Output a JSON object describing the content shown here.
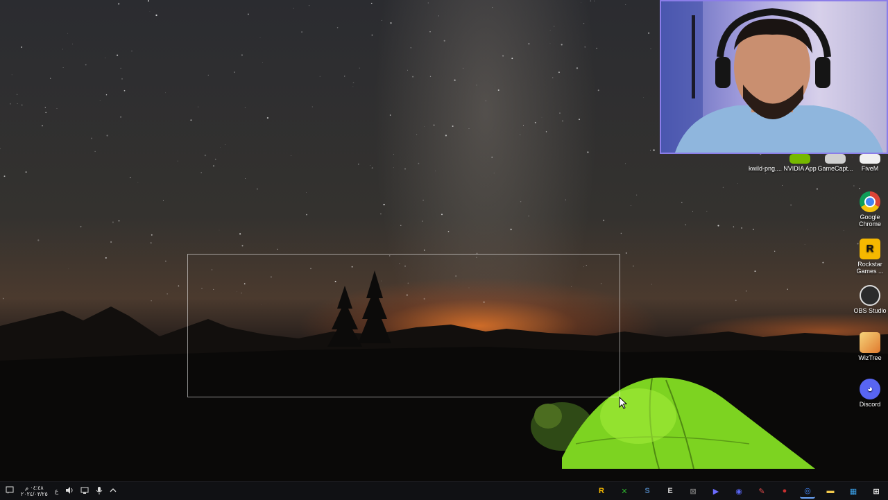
{
  "desktop_icons": [
    {
      "label": "kwild-png....",
      "icon": "image-file-icon",
      "color": "#9b8bd1"
    },
    {
      "label": "NVIDIA App",
      "icon": "nvidia-icon",
      "color": "#76b900"
    },
    {
      "label": "GameCapt...",
      "icon": "game-capture-icon",
      "color": "#c9c9c9"
    },
    {
      "label": "FiveM",
      "icon": "fivem-icon",
      "color": "#ffffff"
    },
    {
      "label": "Google Chrome",
      "icon": "chrome-icon",
      "color": "#4285f4"
    },
    {
      "label": "Rockstar Games ...",
      "icon": "rockstar-icon",
      "color": "#f5b800"
    },
    {
      "label": "OBS Studio",
      "icon": "obs-icon",
      "color": "#2b2b2b"
    },
    {
      "label": "WizTree",
      "icon": "wiztree-icon",
      "color": "#e89a3c"
    },
    {
      "label": "Discord",
      "icon": "discord-icon",
      "color": "#5865f2"
    }
  ],
  "taskbar": {
    "clock_time": "٠٤:٤٨ م",
    "clock_date": "٢٠٢٤/٠٣/٢٥",
    "language": "ع",
    "tray_icons": [
      "notification-icon",
      "volume-icon",
      "network-icon",
      "microphone-icon",
      "show-hidden-icons-chevron"
    ],
    "apps": [
      {
        "name": "rockstar-launcher-icon",
        "glyph": "R",
        "color": "#f5b800"
      },
      {
        "name": "xbox-icon",
        "glyph": "✕",
        "color": "#2fb52f"
      },
      {
        "name": "steam-icon",
        "glyph": "S",
        "color": "#4a7bb0"
      },
      {
        "name": "epic-icon",
        "glyph": "E",
        "color": "#d0d0d0"
      },
      {
        "name": "xbox-gamebar-icon",
        "glyph": "⊠",
        "color": "#7a7a7a"
      },
      {
        "name": "media-player-icon",
        "glyph": "▶",
        "color": "#6c6cff"
      },
      {
        "name": "discord-taskbar-icon",
        "glyph": "◉",
        "color": "#5865f2"
      },
      {
        "name": "feather-app-icon",
        "glyph": "✎",
        "color": "#e04a4a"
      },
      {
        "name": "obs-taskbar-icon",
        "glyph": "●",
        "color": "#c93030"
      },
      {
        "name": "chrome-taskbar-icon",
        "glyph": "◎",
        "color": "#4285f4"
      },
      {
        "name": "file-explorer-icon",
        "glyph": "▬",
        "color": "#f2c94c"
      },
      {
        "name": "store-icon",
        "glyph": "▦",
        "color": "#3aa0e8"
      },
      {
        "name": "start-button-icon",
        "glyph": "⊞",
        "color": "#ffffff"
      }
    ]
  }
}
